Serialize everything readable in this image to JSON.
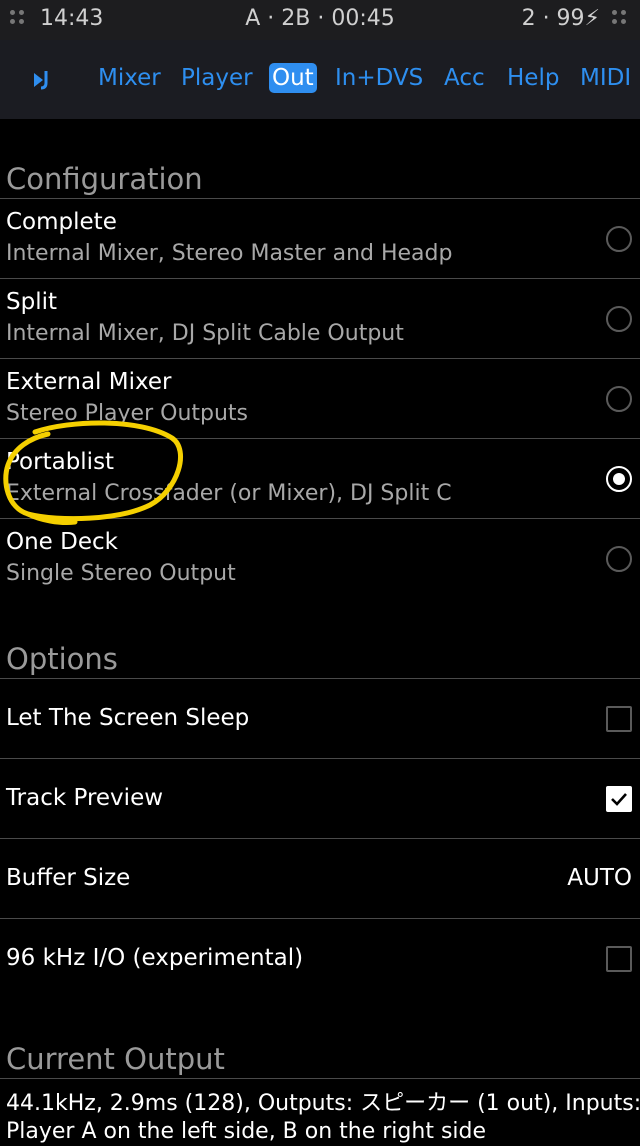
{
  "status_bar": {
    "time": "14:43",
    "center": "A · 2B · 00:45",
    "right": "2 · 99⚡"
  },
  "nav": {
    "tabs": [
      {
        "label": "Mixer"
      },
      {
        "label": "Player"
      },
      {
        "label": "Out",
        "active": true
      },
      {
        "label": "In+DVS"
      },
      {
        "label": "Acc"
      },
      {
        "label": "Help"
      },
      {
        "label": "MIDI"
      }
    ]
  },
  "configuration": {
    "header": "Configuration",
    "items": [
      {
        "title": "Complete",
        "subtitle": "Internal Mixer, Stereo Master and Headp",
        "selected": false
      },
      {
        "title": "Split",
        "subtitle": "Internal Mixer, DJ Split Cable Output",
        "selected": false
      },
      {
        "title": "External Mixer",
        "subtitle": "Stereo Player Outputs",
        "selected": false
      },
      {
        "title": "Portablist",
        "subtitle": "External Crossfader (or Mixer), DJ Split C",
        "selected": true
      },
      {
        "title": "One Deck",
        "subtitle": "Single Stereo Output",
        "selected": false
      }
    ]
  },
  "options": {
    "header": "Options",
    "screen_sleep": {
      "label": "Let The Screen Sleep",
      "checked": false
    },
    "track_preview": {
      "label": "Track Preview",
      "checked": true
    },
    "buffer_size": {
      "label": "Buffer Size",
      "value": "AUTO"
    },
    "khz96": {
      "label": "96 kHz I/O (experimental)",
      "checked": false
    }
  },
  "current_output": {
    "header": "Current Output",
    "line1": "44.1kHz, 2.9ms (128), Outputs: スピーカー (1 out), Inputs:",
    "line2": "Player A on the left side, B on the right side"
  },
  "colors": {
    "accent": "#2f8ef0",
    "annotation": "#f5d000",
    "background": "#000000"
  }
}
